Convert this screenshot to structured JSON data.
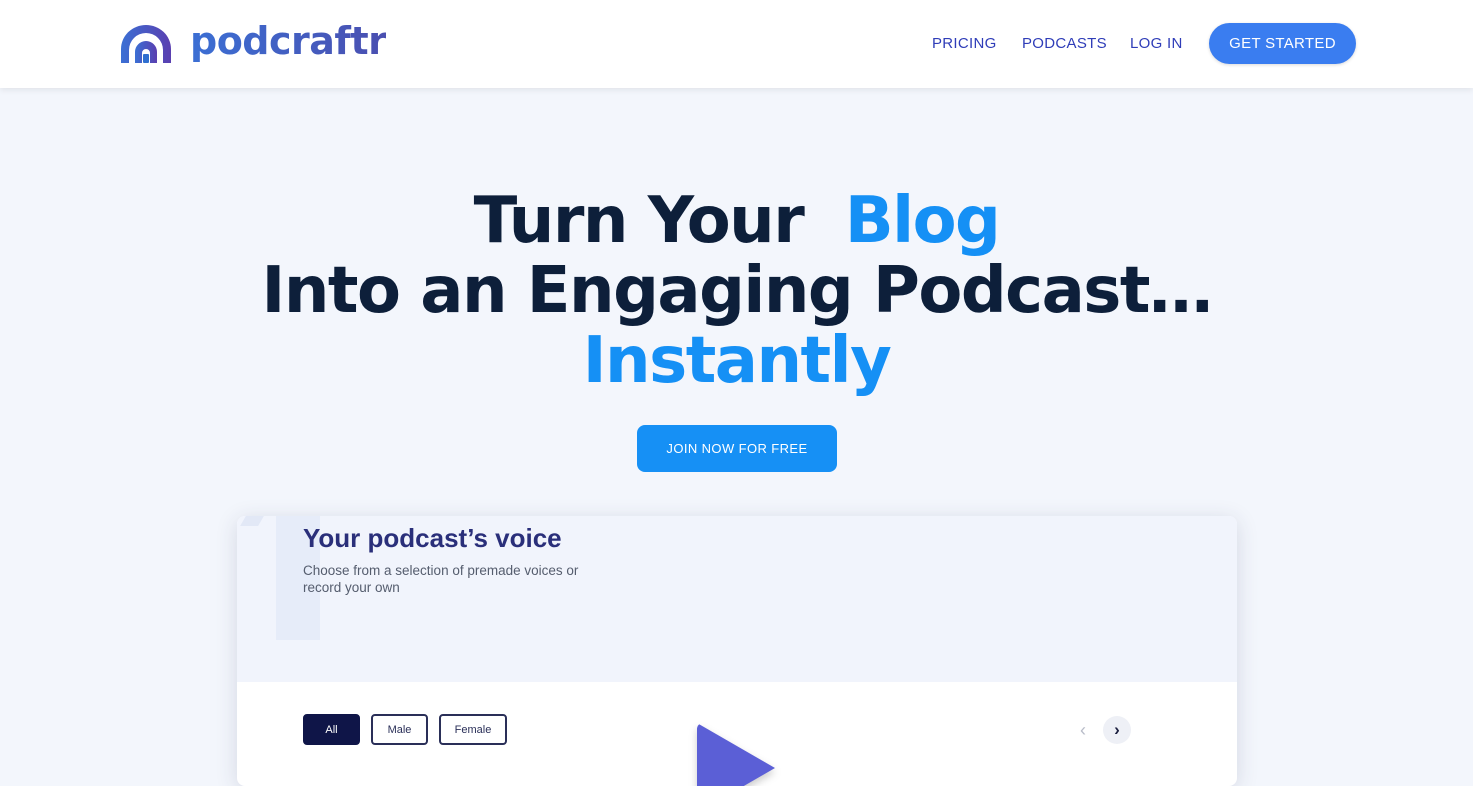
{
  "brand": {
    "name": "podcraftr",
    "logo_icon": "podcraftr-logo-icon"
  },
  "nav": {
    "pricing": "PRICING",
    "podcasts": "PODCASTS",
    "login": "LOG IN",
    "get_started": "GET STARTED"
  },
  "hero": {
    "line1_dark": "Turn Your",
    "line1_accent": "Blog",
    "line2": "Into an Engaging Podcast…",
    "line3_accent": "Instantly",
    "cta": "JOIN NOW FOR FREE"
  },
  "card": {
    "title": "Your podcast’s voice",
    "subtitle": "Choose from a selection of premade voices or record your own",
    "filters": [
      "All",
      "Male",
      "Female"
    ],
    "active_filter": "All",
    "play_icon": "play-icon",
    "prev_icon": "chevron-left-icon",
    "next_icon": "chevron-right-icon"
  },
  "colors": {
    "accent": "#1690f5",
    "nav_text": "#2f3db8",
    "button": "#3a7df0",
    "heading": "#0d1f3a",
    "card_title": "#2a2f7a"
  }
}
